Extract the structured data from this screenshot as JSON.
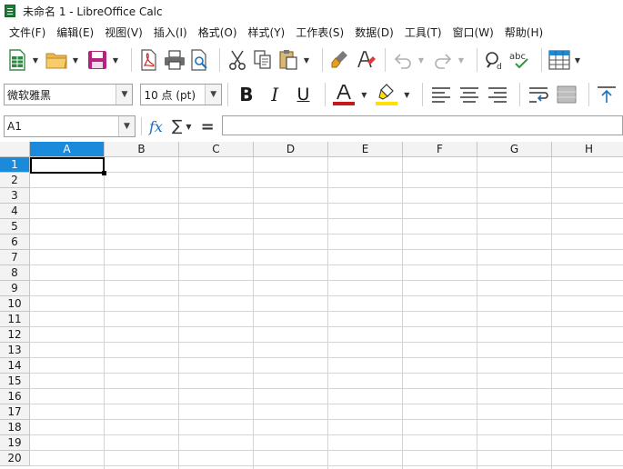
{
  "window": {
    "title": "未命名 1 - LibreOffice Calc"
  },
  "menu": [
    "文件(F)",
    "编辑(E)",
    "视图(V)",
    "插入(I)",
    "格式(O)",
    "样式(Y)",
    "工作表(S)",
    "数据(D)",
    "工具(T)",
    "窗口(W)",
    "帮助(H)"
  ],
  "formatting": {
    "font_name": "微软雅黑",
    "font_size": "10 点 (pt)",
    "font_color": "#c8191a",
    "highlight_color": "#ffe000"
  },
  "formula_bar": {
    "name_box": "A1",
    "fx_label": "fx",
    "sum_symbol": "∑",
    "equals_symbol": "=",
    "formula": ""
  },
  "sheet": {
    "columns": [
      "A",
      "B",
      "C",
      "D",
      "E",
      "F",
      "G",
      "H"
    ],
    "rows": [
      "1",
      "2",
      "3",
      "4",
      "5",
      "6",
      "7",
      "8",
      "9",
      "10",
      "11",
      "12",
      "13",
      "14",
      "15",
      "16",
      "17",
      "18",
      "19",
      "20"
    ],
    "active_cell": "A1",
    "accent": "#1c8adb"
  }
}
